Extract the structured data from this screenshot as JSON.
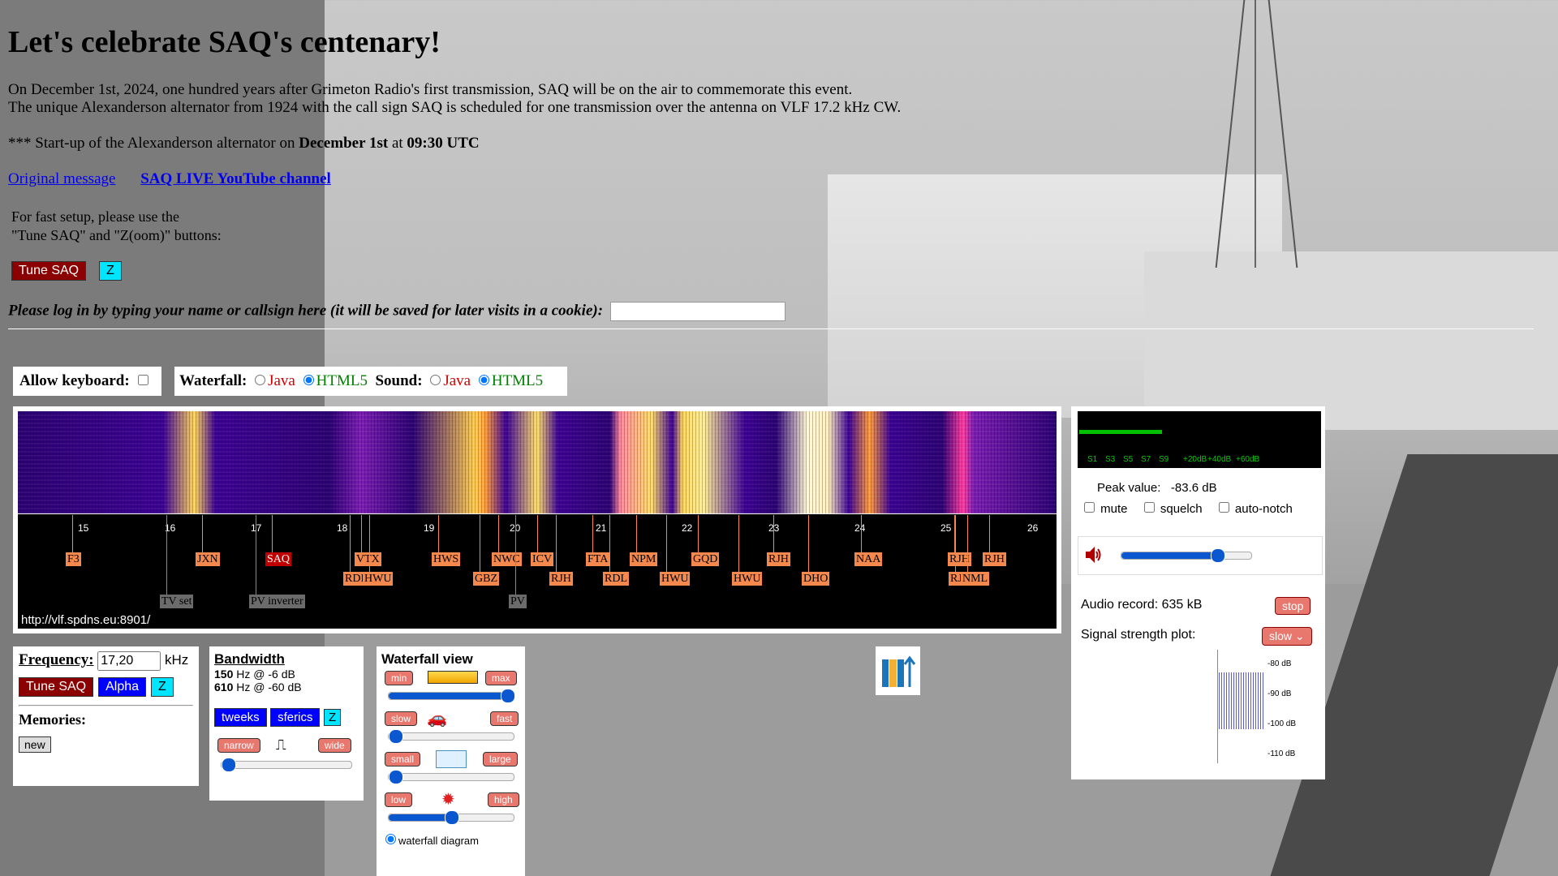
{
  "page": {
    "title": "Let's celebrate SAQ's centenary!",
    "intro_line1": "On December 1st, 2024, one hundred years after Grimeton Radio's first transmission, SAQ will be on the air to commemorate this event.",
    "intro_line2": "The unique Alexanderson alternator from 1924 with the call sign SAQ is scheduled for one transmission over the antenna on VLF 17.2 kHz CW.",
    "startup_prefix": "*** Start-up of the Alexanderson alternator on ",
    "startup_date": "December 1st",
    "startup_mid": " at ",
    "startup_time": "09:30 UTC",
    "link_original": "Original message",
    "link_youtube": "SAQ LIVE YouTube channel",
    "setup_line1": "For fast setup, please use the",
    "setup_line2": "\"Tune SAQ\" and \"Z(oom)\" buttons:",
    "tune_saq": "Tune SAQ",
    "zoom": "Z",
    "login_prompt": "Please log in by typing your name or callsign here (it will be saved for later visits in a cookie):",
    "login_value": ""
  },
  "options": {
    "allow_keyboard": "Allow keyboard:",
    "waterfall": "Waterfall:",
    "sound": "Sound:",
    "java": "Java",
    "html5": "HTML5"
  },
  "waterfall": {
    "ticks": [
      "15",
      "16",
      "17",
      "18",
      "19",
      "20",
      "21",
      "22",
      "23",
      "24",
      "25",
      "26"
    ],
    "url": "http://vlf.spdns.eu:8901/",
    "stations": [
      {
        "label": "F3",
        "kind": "normal"
      },
      {
        "label": "JXN",
        "kind": "normal"
      },
      {
        "label": "SAQ",
        "kind": "selected"
      },
      {
        "label": "VTX",
        "kind": "normal"
      },
      {
        "label": "RDL",
        "kind": "normal"
      },
      {
        "label": "HWU",
        "kind": "normal"
      },
      {
        "label": "HWS",
        "kind": "normal"
      },
      {
        "label": "GBZ",
        "kind": "normal"
      },
      {
        "label": "NWC",
        "kind": "normal"
      },
      {
        "label": "ICV",
        "kind": "normal"
      },
      {
        "label": "RJH",
        "kind": "normal"
      },
      {
        "label": "FTA",
        "kind": "normal"
      },
      {
        "label": "RDL",
        "kind": "normal"
      },
      {
        "label": "NPM",
        "kind": "normal"
      },
      {
        "label": "HWU",
        "kind": "normal"
      },
      {
        "label": "GQD",
        "kind": "normal"
      },
      {
        "label": "HWU",
        "kind": "normal"
      },
      {
        "label": "RJH",
        "kind": "normal"
      },
      {
        "label": "DHO",
        "kind": "normal"
      },
      {
        "label": "NAA",
        "kind": "normal"
      },
      {
        "label": "RJH",
        "kind": "normal"
      },
      {
        "label": "RJH",
        "kind": "normal"
      },
      {
        "label": "NML",
        "kind": "normal"
      },
      {
        "label": "RJH",
        "kind": "normal"
      },
      {
        "label": "TV set",
        "kind": "gray"
      },
      {
        "label": "PV inverter",
        "kind": "gray"
      },
      {
        "label": "PV",
        "kind": "gray"
      }
    ]
  },
  "smeter": {
    "labels": [
      "S1",
      "S3",
      "S5",
      "S7",
      "S9",
      "+20dB",
      "+40dB",
      "+60dB"
    ],
    "level": 0.34,
    "peak_label": "Peak value:",
    "peak_value": "-83.6 dB",
    "mute": "mute",
    "squelch": "squelch",
    "autonotch": "auto-notch",
    "volume": 0.74,
    "audio_record_label": "Audio record: ",
    "audio_record_value": "635 kB",
    "stop": "stop",
    "plot_label": "Signal strength plot:",
    "plot_speed": "slow",
    "plot_ticks": [
      "-80 dB",
      "-90 dB",
      "-100 dB",
      "-110 dB"
    ]
  },
  "frequency": {
    "label": "Frequency:",
    "value": "17,20",
    "unit": "kHz",
    "tune_saq": "Tune SAQ",
    "alpha": "Alpha",
    "zoom": "Z",
    "memories": "Memories:",
    "new": "new"
  },
  "bandwidth": {
    "title": "Bandwidth",
    "line1_hz": "150",
    "line1_rest": " Hz @ -6 dB",
    "line2_hz": "610",
    "line2_rest": " Hz @ -60 dB",
    "tweeks": "tweeks",
    "sferics": "sferics",
    "zoom": "Z",
    "narrow": "narrow",
    "wide": "wide",
    "slider": 0.05
  },
  "waterfall_view": {
    "title": "Waterfall view",
    "min": "min",
    "max": "max",
    "slow": "slow",
    "fast": "fast",
    "small": "small",
    "large": "large",
    "low": "low",
    "high": "high",
    "range_slider": 0.95,
    "speed_slider": 0.05,
    "size_slider": 0.05,
    "brightness_slider": 0.5,
    "diagram_option": "waterfall diagram"
  }
}
